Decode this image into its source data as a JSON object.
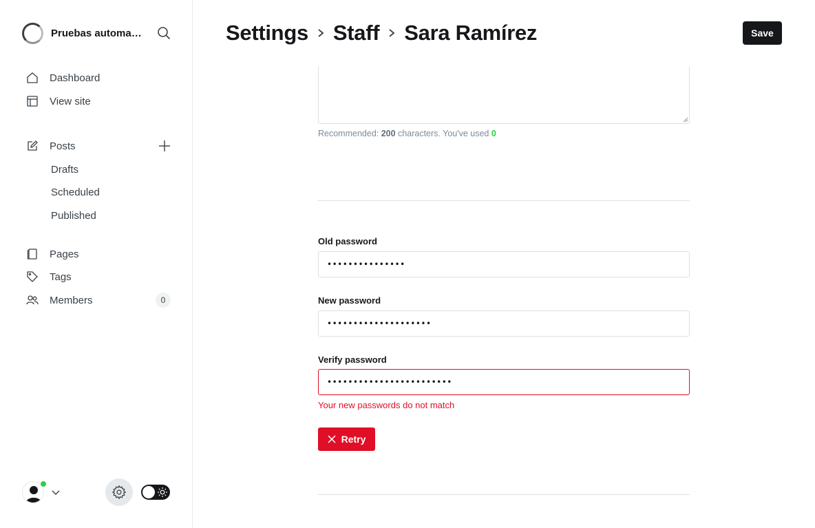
{
  "sidebar": {
    "site_title": "Pruebas automatizadas",
    "nav": {
      "dashboard": "Dashboard",
      "view_site": "View site",
      "posts": "Posts",
      "drafts": "Drafts",
      "scheduled": "Scheduled",
      "published": "Published",
      "pages": "Pages",
      "tags": "Tags",
      "members": "Members",
      "members_count": "0"
    },
    "icons": [
      "search-icon",
      "home-icon",
      "layout-icon",
      "edit-icon",
      "plus-icon",
      "page-icon",
      "tag-icon",
      "members-icon",
      "chevron-down-icon",
      "gear-icon",
      "sun-icon"
    ],
    "status_color": "#30cf43"
  },
  "header": {
    "breadcrumb": [
      "Settings",
      "Staff",
      "Sara Ramírez"
    ],
    "save_label": "Save"
  },
  "bio": {
    "hint_prefix": "Recommended: ",
    "hint_limit": "200",
    "hint_middle": " characters. You've used ",
    "hint_used": "0"
  },
  "password": {
    "old_label": "Old password",
    "old_value": "•••••••••••••••",
    "new_label": "New password",
    "new_value": "••••••••••••••••••••",
    "verify_label": "Verify password",
    "verify_value": "••••••••••••••••••••••••",
    "error": "Your new passwords do not match",
    "retry_label": "Retry"
  },
  "colors": {
    "accent_dark": "#15171a",
    "error_red": "#e10e27",
    "success_green": "#30cf43"
  }
}
